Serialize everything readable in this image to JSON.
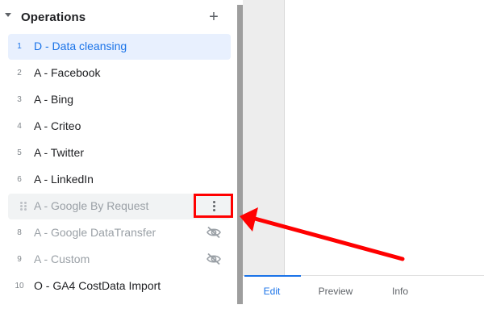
{
  "panel": {
    "title": "Operations",
    "add_label": "+"
  },
  "operations": [
    {
      "num": "1",
      "label": "D - Data cleansing",
      "state": "selected"
    },
    {
      "num": "2",
      "label": "A - Facebook",
      "state": "normal"
    },
    {
      "num": "3",
      "label": "A - Bing",
      "state": "normal"
    },
    {
      "num": "4",
      "label": "A - Criteo",
      "state": "normal"
    },
    {
      "num": "5",
      "label": "A - Twitter",
      "state": "normal"
    },
    {
      "num": "6",
      "label": "A - LinkedIn",
      "state": "normal"
    },
    {
      "num": "",
      "label": "A - Google By Request",
      "state": "hovered"
    },
    {
      "num": "8",
      "label": "A - Google DataTransfer",
      "state": "disabled"
    },
    {
      "num": "9",
      "label": "A - Custom",
      "state": "disabled"
    },
    {
      "num": "10",
      "label": "O - GA4 CostData Import",
      "state": "normal"
    }
  ],
  "tabs": {
    "edit": "Edit",
    "preview": "Preview",
    "info": "Info",
    "active": "edit"
  },
  "colors": {
    "accent": "#1a73e8",
    "annotation": "#ff0000"
  },
  "icons": {
    "caret": "caret-down-icon",
    "add": "plus-icon",
    "more": "more-vert-icon",
    "hidden": "eye-off-icon",
    "drag": "drag-handle-icon"
  }
}
